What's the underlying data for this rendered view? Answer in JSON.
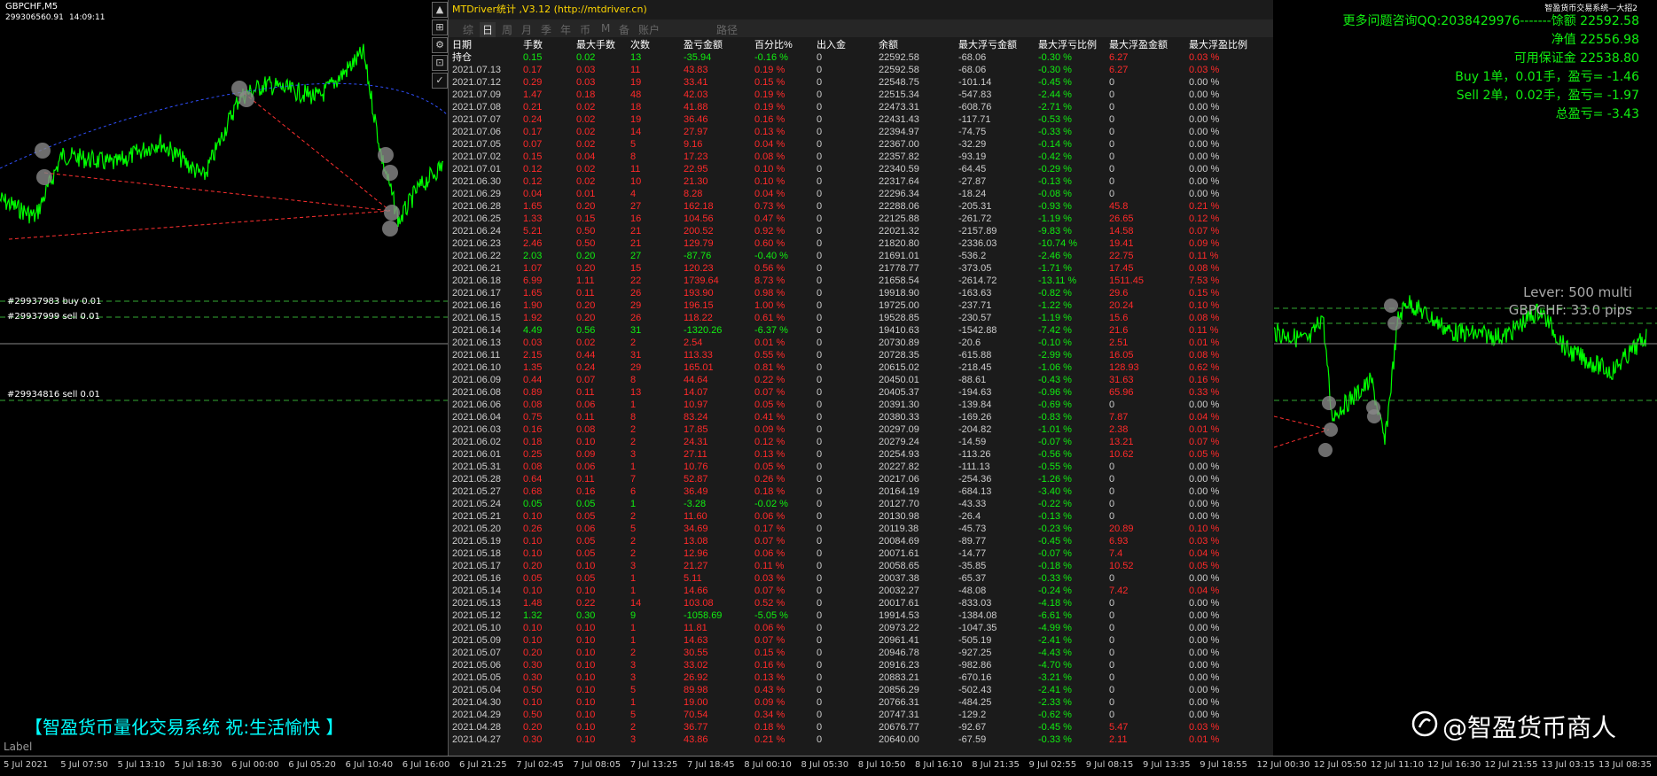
{
  "left_chart": {
    "symbol": "GBPCHF,M5",
    "account": "299306560.91",
    "time": "14:09:11",
    "orders": [
      "#29937983 buy 0.01",
      "#29937999 sell 0.01",
      "#29934816 sell 0.01"
    ],
    "brand": "【智盈货币量化交易系统  祝:生活愉快 】",
    "label": "Label",
    "line_color": "#00ff00"
  },
  "panel": {
    "title": "MTDriver统计 ,V3.12 (http://mtdriver.cn)",
    "tabs": [
      "综",
      "日",
      "周",
      "月",
      "季",
      "年",
      "币",
      "M",
      "备",
      "账户",
      "路径"
    ],
    "active_tab": "日",
    "headers": [
      "日期",
      "手数",
      "最大手数",
      "次数",
      "盈亏金额",
      "百分比%",
      "出入金",
      "余额",
      "最大浮亏金额",
      "最大浮亏比例",
      "最大浮盈金额",
      "最大浮盈比例"
    ],
    "rows": [
      [
        "持仓",
        "0.15",
        "0.02",
        "13",
        "-35.94",
        "-0.16 %",
        "0",
        "22592.58",
        "-68.06",
        "-0.30 %",
        "6.27",
        "0.03 %"
      ],
      [
        "2021.07.13",
        "0.17",
        "0.03",
        "11",
        "43.83",
        "0.19 %",
        "0",
        "22592.58",
        "-68.06",
        "-0.30 %",
        "6.27",
        "0.03 %"
      ],
      [
        "2021.07.12",
        "0.29",
        "0.03",
        "19",
        "33.41",
        "0.15 %",
        "0",
        "22548.75",
        "-101.14",
        "-0.45 %",
        "0",
        "0.00 %"
      ],
      [
        "2021.07.09",
        "1.47",
        "0.18",
        "48",
        "42.03",
        "0.19 %",
        "0",
        "22515.34",
        "-547.83",
        "-2.44 %",
        "0",
        "0.00 %"
      ],
      [
        "2021.07.08",
        "0.21",
        "0.02",
        "18",
        "41.88",
        "0.19 %",
        "0",
        "22473.31",
        "-608.76",
        "-2.71 %",
        "0",
        "0.00 %"
      ],
      [
        "2021.07.07",
        "0.24",
        "0.02",
        "19",
        "36.46",
        "0.16 %",
        "0",
        "22431.43",
        "-117.71",
        "-0.53 %",
        "0",
        "0.00 %"
      ],
      [
        "2021.07.06",
        "0.17",
        "0.02",
        "14",
        "27.97",
        "0.13 %",
        "0",
        "22394.97",
        "-74.75",
        "-0.33 %",
        "0",
        "0.00 %"
      ],
      [
        "2021.07.05",
        "0.07",
        "0.02",
        "5",
        "9.16",
        "0.04 %",
        "0",
        "22367.00",
        "-32.29",
        "-0.14 %",
        "0",
        "0.00 %"
      ],
      [
        "2021.07.02",
        "0.15",
        "0.04",
        "8",
        "17.23",
        "0.08 %",
        "0",
        "22357.82",
        "-93.19",
        "-0.42 %",
        "0",
        "0.00 %"
      ],
      [
        "2021.07.01",
        "0.12",
        "0.02",
        "11",
        "22.95",
        "0.10 %",
        "0",
        "22340.59",
        "-64.45",
        "-0.29 %",
        "0",
        "0.00 %"
      ],
      [
        "2021.06.30",
        "0.12",
        "0.02",
        "10",
        "21.30",
        "0.10 %",
        "0",
        "22317.64",
        "-27.87",
        "-0.13 %",
        "0",
        "0.00 %"
      ],
      [
        "2021.06.29",
        "0.04",
        "0.01",
        "4",
        "8.28",
        "0.04 %",
        "0",
        "22296.34",
        "-18.24",
        "-0.08 %",
        "0",
        "0.00 %"
      ],
      [
        "2021.06.28",
        "1.65",
        "0.20",
        "27",
        "162.18",
        "0.73 %",
        "0",
        "22288.06",
        "-205.31",
        "-0.93 %",
        "45.8",
        "0.21 %"
      ],
      [
        "2021.06.25",
        "1.33",
        "0.15",
        "16",
        "104.56",
        "0.47 %",
        "0",
        "22125.88",
        "-261.72",
        "-1.19 %",
        "26.65",
        "0.12 %"
      ],
      [
        "2021.06.24",
        "5.21",
        "0.50",
        "21",
        "200.52",
        "0.92 %",
        "0",
        "22021.32",
        "-2157.89",
        "-9.83 %",
        "14.58",
        "0.07 %"
      ],
      [
        "2021.06.23",
        "2.46",
        "0.50",
        "21",
        "129.79",
        "0.60 %",
        "0",
        "21820.80",
        "-2336.03",
        "-10.74 %",
        "19.41",
        "0.09 %"
      ],
      [
        "2021.06.22",
        "2.03",
        "0.20",
        "27",
        "-87.76",
        "-0.40 %",
        "0",
        "21691.01",
        "-536.2",
        "-2.46 %",
        "22.75",
        "0.11 %"
      ],
      [
        "2021.06.21",
        "1.07",
        "0.20",
        "15",
        "120.23",
        "0.56 %",
        "0",
        "21778.77",
        "-373.05",
        "-1.71 %",
        "17.45",
        "0.08 %"
      ],
      [
        "2021.06.18",
        "6.99",
        "1.11",
        "22",
        "1739.64",
        "8.73 %",
        "0",
        "21658.54",
        "-2614.72",
        "-13.11 %",
        "1511.45",
        "7.53 %"
      ],
      [
        "2021.06.17",
        "1.65",
        "0.11",
        "26",
        "193.90",
        "0.98 %",
        "0",
        "19918.90",
        "-163.63",
        "-0.82 %",
        "29.6",
        "0.15 %"
      ],
      [
        "2021.06.16",
        "1.90",
        "0.20",
        "29",
        "196.15",
        "1.00 %",
        "0",
        "19725.00",
        "-237.71",
        "-1.22 %",
        "20.24",
        "0.10 %"
      ],
      [
        "2021.06.15",
        "1.92",
        "0.20",
        "26",
        "118.22",
        "0.61 %",
        "0",
        "19528.85",
        "-230.57",
        "-1.19 %",
        "15.6",
        "0.08 %"
      ],
      [
        "2021.06.14",
        "4.49",
        "0.56",
        "31",
        "-1320.26",
        "-6.37 %",
        "0",
        "19410.63",
        "-1542.88",
        "-7.42 %",
        "21.6",
        "0.11 %"
      ],
      [
        "2021.06.13",
        "0.03",
        "0.02",
        "2",
        "2.54",
        "0.01 %",
        "0",
        "20730.89",
        "-20.6",
        "-0.10 %",
        "2.51",
        "0.01 %"
      ],
      [
        "2021.06.11",
        "2.15",
        "0.44",
        "31",
        "113.33",
        "0.55 %",
        "0",
        "20728.35",
        "-615.88",
        "-2.99 %",
        "16.05",
        "0.08 %"
      ],
      [
        "2021.06.10",
        "1.35",
        "0.24",
        "29",
        "165.01",
        "0.81 %",
        "0",
        "20615.02",
        "-218.45",
        "-1.06 %",
        "128.93",
        "0.62 %"
      ],
      [
        "2021.06.09",
        "0.44",
        "0.07",
        "8",
        "44.64",
        "0.22 %",
        "0",
        "20450.01",
        "-88.61",
        "-0.43 %",
        "31.63",
        "0.16 %"
      ],
      [
        "2021.06.08",
        "0.89",
        "0.11",
        "13",
        "14.07",
        "0.07 %",
        "0",
        "20405.37",
        "-194.63",
        "-0.96 %",
        "65.96",
        "0.33 %"
      ],
      [
        "2021.06.06",
        "0.08",
        "0.06",
        "1",
        "10.97",
        "0.05 %",
        "0",
        "20391.30",
        "-139.84",
        "-0.69 %",
        "0",
        "0.00 %"
      ],
      [
        "2021.06.04",
        "0.75",
        "0.11",
        "8",
        "83.24",
        "0.41 %",
        "0",
        "20380.33",
        "-169.26",
        "-0.83 %",
        "7.87",
        "0.04 %"
      ],
      [
        "2021.06.03",
        "0.16",
        "0.08",
        "2",
        "17.85",
        "0.09 %",
        "0",
        "20297.09",
        "-204.82",
        "-1.01 %",
        "2.38",
        "0.01 %"
      ],
      [
        "2021.06.02",
        "0.18",
        "0.10",
        "2",
        "24.31",
        "0.12 %",
        "0",
        "20279.24",
        "-14.59",
        "-0.07 %",
        "13.21",
        "0.07 %"
      ],
      [
        "2021.06.01",
        "0.25",
        "0.09",
        "3",
        "27.11",
        "0.13 %",
        "0",
        "20254.93",
        "-113.26",
        "-0.56 %",
        "10.62",
        "0.05 %"
      ],
      [
        "2021.05.31",
        "0.08",
        "0.06",
        "1",
        "10.76",
        "0.05 %",
        "0",
        "20227.82",
        "-111.13",
        "-0.55 %",
        "0",
        "0.00 %"
      ],
      [
        "2021.05.28",
        "0.64",
        "0.11",
        "7",
        "52.87",
        "0.26 %",
        "0",
        "20217.06",
        "-254.36",
        "-1.26 %",
        "0",
        "0.00 %"
      ],
      [
        "2021.05.27",
        "0.68",
        "0.16",
        "6",
        "36.49",
        "0.18 %",
        "0",
        "20164.19",
        "-684.13",
        "-3.40 %",
        "0",
        "0.00 %"
      ],
      [
        "2021.05.24",
        "0.05",
        "0.05",
        "1",
        "-3.28",
        "-0.02 %",
        "0",
        "20127.70",
        "-43.33",
        "-0.22 %",
        "0",
        "0.00 %"
      ],
      [
        "2021.05.21",
        "0.10",
        "0.05",
        "2",
        "11.60",
        "0.06 %",
        "0",
        "20130.98",
        "-26.4",
        "-0.13 %",
        "0",
        "0.00 %"
      ],
      [
        "2021.05.20",
        "0.26",
        "0.06",
        "5",
        "34.69",
        "0.17 %",
        "0",
        "20119.38",
        "-45.73",
        "-0.23 %",
        "20.89",
        "0.10 %"
      ],
      [
        "2021.05.19",
        "0.10",
        "0.05",
        "2",
        "13.08",
        "0.07 %",
        "0",
        "20084.69",
        "-89.77",
        "-0.45 %",
        "6.93",
        "0.03 %"
      ],
      [
        "2021.05.18",
        "0.10",
        "0.05",
        "2",
        "12.96",
        "0.06 %",
        "0",
        "20071.61",
        "-14.77",
        "-0.07 %",
        "7.4",
        "0.04 %"
      ],
      [
        "2021.05.17",
        "0.20",
        "0.10",
        "3",
        "21.27",
        "0.11 %",
        "0",
        "20058.65",
        "-35.85",
        "-0.18 %",
        "10.52",
        "0.05 %"
      ],
      [
        "2021.05.16",
        "0.05",
        "0.05",
        "1",
        "5.11",
        "0.03 %",
        "0",
        "20037.38",
        "-65.37",
        "-0.33 %",
        "0",
        "0.00 %"
      ],
      [
        "2021.05.14",
        "0.10",
        "0.10",
        "1",
        "14.66",
        "0.07 %",
        "0",
        "20032.27",
        "-48.08",
        "-0.24 %",
        "7.42",
        "0.04 %"
      ],
      [
        "2021.05.13",
        "1.48",
        "0.22",
        "14",
        "103.08",
        "0.52 %",
        "0",
        "20017.61",
        "-833.03",
        "-4.18 %",
        "0",
        "0.00 %"
      ],
      [
        "2021.05.12",
        "1.32",
        "0.30",
        "9",
        "-1058.69",
        "-5.05 %",
        "0",
        "19914.53",
        "-1384.08",
        "-6.61 %",
        "0",
        "0.00 %"
      ],
      [
        "2021.05.10",
        "0.10",
        "0.10",
        "1",
        "11.81",
        "0.06 %",
        "0",
        "20973.22",
        "-1047.35",
        "-4.99 %",
        "0",
        "0.00 %"
      ],
      [
        "2021.05.09",
        "0.10",
        "0.10",
        "1",
        "14.63",
        "0.07 %",
        "0",
        "20961.41",
        "-505.19",
        "-2.41 %",
        "0",
        "0.00 %"
      ],
      [
        "2021.05.07",
        "0.20",
        "0.10",
        "2",
        "30.55",
        "0.15 %",
        "0",
        "20946.78",
        "-927.25",
        "-4.43 %",
        "0",
        "0.00 %"
      ],
      [
        "2021.05.06",
        "0.30",
        "0.10",
        "3",
        "33.02",
        "0.16 %",
        "0",
        "20916.23",
        "-982.86",
        "-4.70 %",
        "0",
        "0.00 %"
      ],
      [
        "2021.05.05",
        "0.30",
        "0.10",
        "3",
        "26.92",
        "0.13 %",
        "0",
        "20883.21",
        "-670.16",
        "-3.21 %",
        "0",
        "0.00 %"
      ],
      [
        "2021.05.04",
        "0.50",
        "0.10",
        "5",
        "89.98",
        "0.43 %",
        "0",
        "20856.29",
        "-502.43",
        "-2.41 %",
        "0",
        "0.00 %"
      ],
      [
        "2021.04.30",
        "0.10",
        "0.10",
        "1",
        "19.00",
        "0.09 %",
        "0",
        "20766.31",
        "-484.25",
        "-2.33 %",
        "0",
        "0.00 %"
      ],
      [
        "2021.04.29",
        "0.50",
        "0.10",
        "5",
        "70.54",
        "0.34 %",
        "0",
        "20747.31",
        "-129.2",
        "-0.62 %",
        "0",
        "0.00 %"
      ],
      [
        "2021.04.28",
        "0.20",
        "0.10",
        "2",
        "36.77",
        "0.18 %",
        "0",
        "20676.77",
        "-92.67",
        "-0.45 %",
        "5.47",
        "0.03 %"
      ],
      [
        "2021.04.27",
        "0.30",
        "0.10",
        "3",
        "43.86",
        "0.21 %",
        "0",
        "20640.00",
        "-67.59",
        "-0.33 %",
        "2.11",
        "0.01 %"
      ]
    ]
  },
  "right_chart": {
    "window_title": "智盈货币交易系统—大招2",
    "info_lines": [
      "更多问题咨询QQ:2038429976-------馀额 22592.58",
      "净值 22556.98",
      "可用保证金 22538.80",
      "Buy 1单，0.01手，盈亏= -1.46",
      "Sell 2单，0.02手，盈亏= -1.97",
      "总盈亏= -3.43"
    ],
    "lever_lines": [
      "Lever: 500 multi",
      "GBPCHF: 33.0 pips"
    ],
    "brand": "@智盈货币商人",
    "brand_icon": "weibo-icon"
  },
  "axis_ticks": [
    "5 Jul 2021",
    "5 Jul 07:50",
    "5 Jul 13:10",
    "5 Jul 18:30",
    "6 Jul 00:00",
    "6 Jul 05:20",
    "6 Jul 10:40",
    "6 Jul 16:00",
    "6 Jul 21:25",
    "7 Jul 02:45",
    "7 Jul 08:05",
    "7 Jul 13:25",
    "7 Jul 18:45",
    "8 Jul 00:10",
    "8 Jul 05:30",
    "8 Jul 10:50",
    "8 Jul 16:10",
    "8 Jul 21:35",
    "9 Jul 02:55",
    "9 Jul 08:15",
    "9 Jul 13:35",
    "9 Jul 18:55",
    "12 Jul 00:30",
    "12 Jul 05:50",
    "12 Jul 11:10",
    "12 Jul 16:30",
    "12 Jul 21:55",
    "13 Jul 03:15",
    "13 Jul 08:35"
  ],
  "colors": {
    "profit": "#ff2a2a",
    "loss": "#11ee11",
    "neutral": "#cccccc",
    "accent": "#ffd700",
    "brand": "#00ffff"
  }
}
